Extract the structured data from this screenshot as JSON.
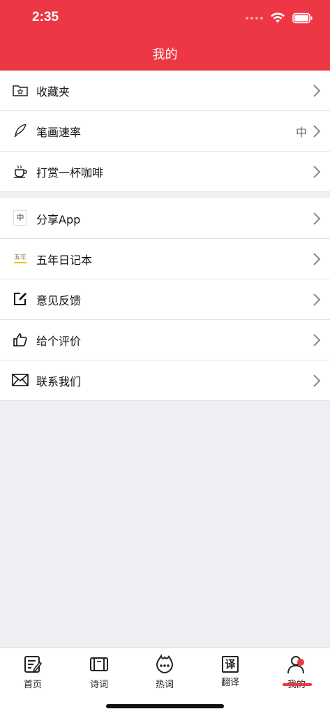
{
  "status_bar": {
    "time": "2:35"
  },
  "header": {
    "title": "我的"
  },
  "groups": [
    {
      "items": [
        {
          "label": "收藏夹",
          "icon": "folder-star-icon"
        },
        {
          "label": "笔画速率",
          "value": "中",
          "icon": "quill-icon"
        },
        {
          "label": "打赏一杯咖啡",
          "icon": "coffee-cup-icon"
        }
      ]
    },
    {
      "items": [
        {
          "label": "分享App",
          "icon": "app-logo-icon",
          "icon_text": "中"
        },
        {
          "label": "五年日记本",
          "icon": "diary-app-icon",
          "icon_text": "五年"
        },
        {
          "label": "意见反馈",
          "icon": "edit-note-icon"
        },
        {
          "label": "给个评价",
          "icon": "thumbs-up-icon"
        },
        {
          "label": "联系我们",
          "icon": "envelope-icon"
        }
      ]
    }
  ],
  "tabbar": {
    "tabs": [
      {
        "label": "首页",
        "icon": "home-doc-icon"
      },
      {
        "label": "诗词",
        "icon": "scroll-icon"
      },
      {
        "label": "热词",
        "icon": "flame-chat-icon"
      },
      {
        "label": "翻译",
        "icon": "translate-icon",
        "icon_text": "译"
      },
      {
        "label": "我的",
        "icon": "person-icon",
        "active": true
      }
    ]
  },
  "colors": {
    "accent": "#ee3744",
    "background": "#efeff4"
  }
}
